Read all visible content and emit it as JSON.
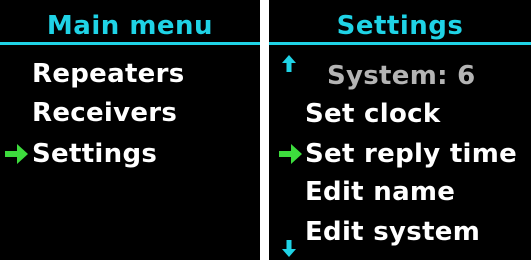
{
  "colors": {
    "accent": "#1fd3e6",
    "selection": "#3ddc3d",
    "text": "#ffffff",
    "dim_text": "#b4b4b4",
    "background": "#000000"
  },
  "main_menu": {
    "title": "Main menu",
    "items": [
      {
        "label": "Repeaters",
        "selected": false
      },
      {
        "label": "Receivers",
        "selected": false
      },
      {
        "label": "Settings",
        "selected": true
      }
    ],
    "selection_icon": "arrow-right-icon"
  },
  "settings_menu": {
    "title": "Settings",
    "items": [
      {
        "label": "System: 6",
        "selected": false,
        "dimmed": true
      },
      {
        "label": "Set clock",
        "selected": false,
        "dimmed": false
      },
      {
        "label": "Set reply time",
        "selected": true,
        "dimmed": false
      },
      {
        "label": "Edit name",
        "selected": false,
        "dimmed": false
      },
      {
        "label": "Edit system",
        "selected": false,
        "dimmed": false
      }
    ],
    "selection_icon": "arrow-right-icon",
    "scroll_up_icon": "arrow-up-icon",
    "scroll_down_icon": "arrow-down-icon"
  }
}
